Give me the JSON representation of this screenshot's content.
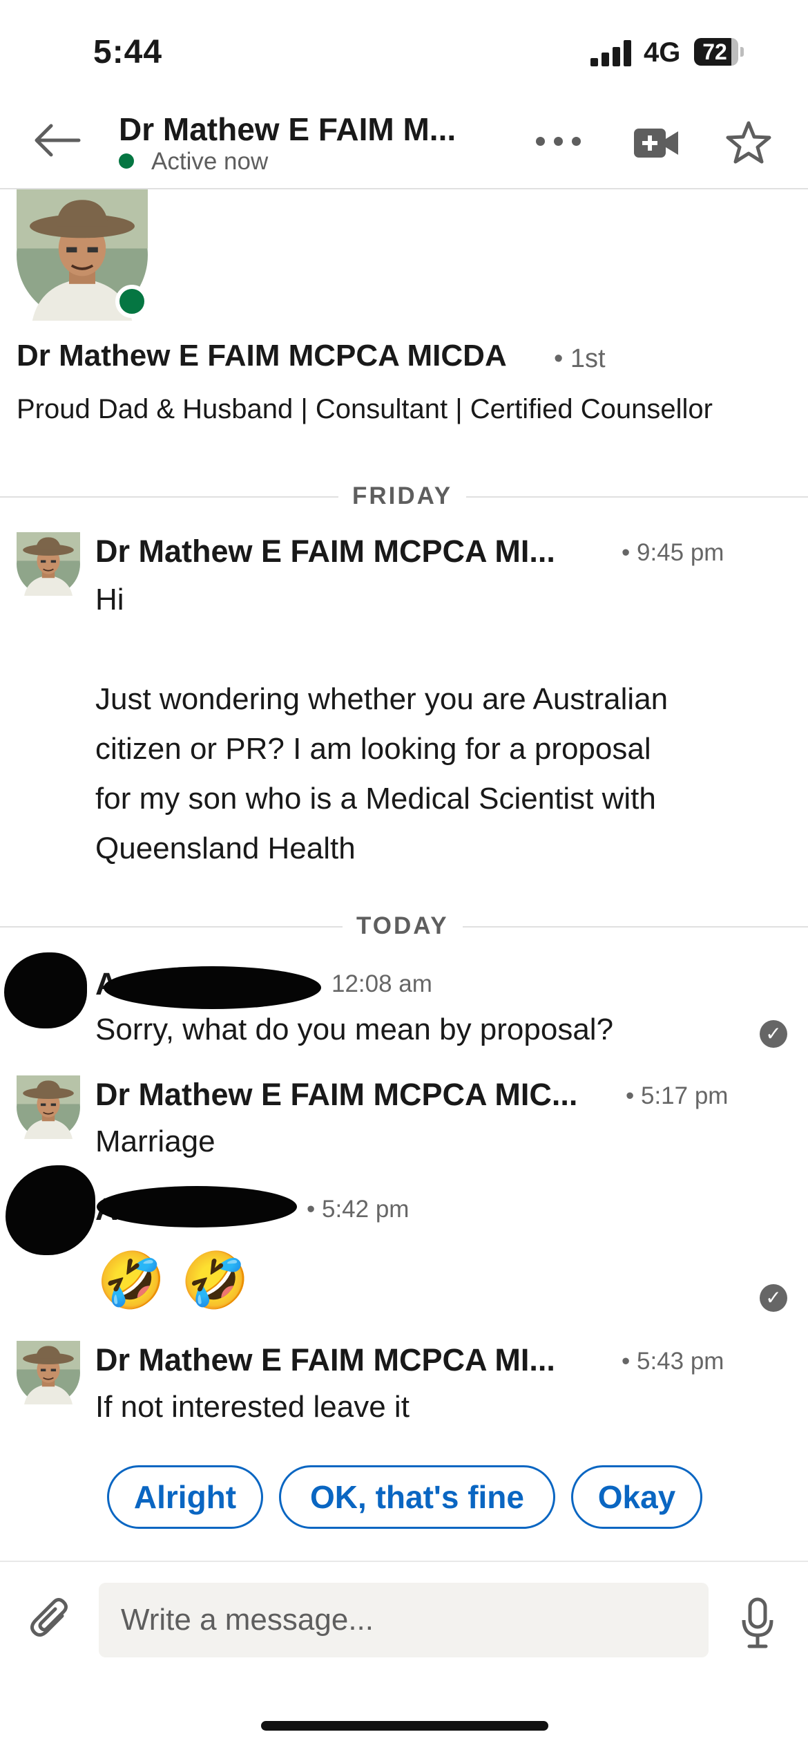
{
  "status_bar": {
    "time": "5:44",
    "network": "4G",
    "battery": "72"
  },
  "header": {
    "back_icon": "arrow-left-icon",
    "title": "Dr Mathew E FAIM M...",
    "presence": "Active now",
    "more_icon": "more-dots-icon",
    "video_icon": "video-call-icon",
    "star_icon": "star-icon"
  },
  "profile": {
    "name": "Dr Mathew E FAIM MCPCA MICDA",
    "degree": "• 1st",
    "headline": "Proud Dad & Husband | Consultant | Certified Counsellor"
  },
  "days": {
    "friday": "FRIDAY",
    "today": "TODAY"
  },
  "messages": [
    {
      "sender": "Dr Mathew E FAIM MCPCA MI...",
      "time": "• 9:45 pm",
      "lines": [
        "Hi",
        "",
        "Just wondering whether you are Australian",
        "citizen or PR? I am looking for a proposal",
        "for my son who is a Medical Scientist with",
        "Queensland Health"
      ]
    },
    {
      "sender": "A",
      "time": "12:08 am",
      "text": "Sorry, what do you mean by proposal?"
    },
    {
      "sender": "Dr Mathew E FAIM MCPCA MIC...",
      "time": "• 5:17 pm",
      "text": "Marriage"
    },
    {
      "sender": "A",
      "time": "• 5:42 pm",
      "text": "🤣 🤣"
    },
    {
      "sender": "Dr Mathew E FAIM MCPCA MI...",
      "time": "• 5:43 pm",
      "text": "If not interested leave it"
    }
  ],
  "quick_replies": [
    "Alright",
    "OK, that's fine",
    "Okay"
  ],
  "composer": {
    "placeholder": "Write a message...",
    "attach_icon": "paperclip-icon",
    "mic_icon": "microphone-icon"
  },
  "colors": {
    "brand_blue": "#0a66c2",
    "online_green": "#057642",
    "divider": "#e0e0e0"
  }
}
